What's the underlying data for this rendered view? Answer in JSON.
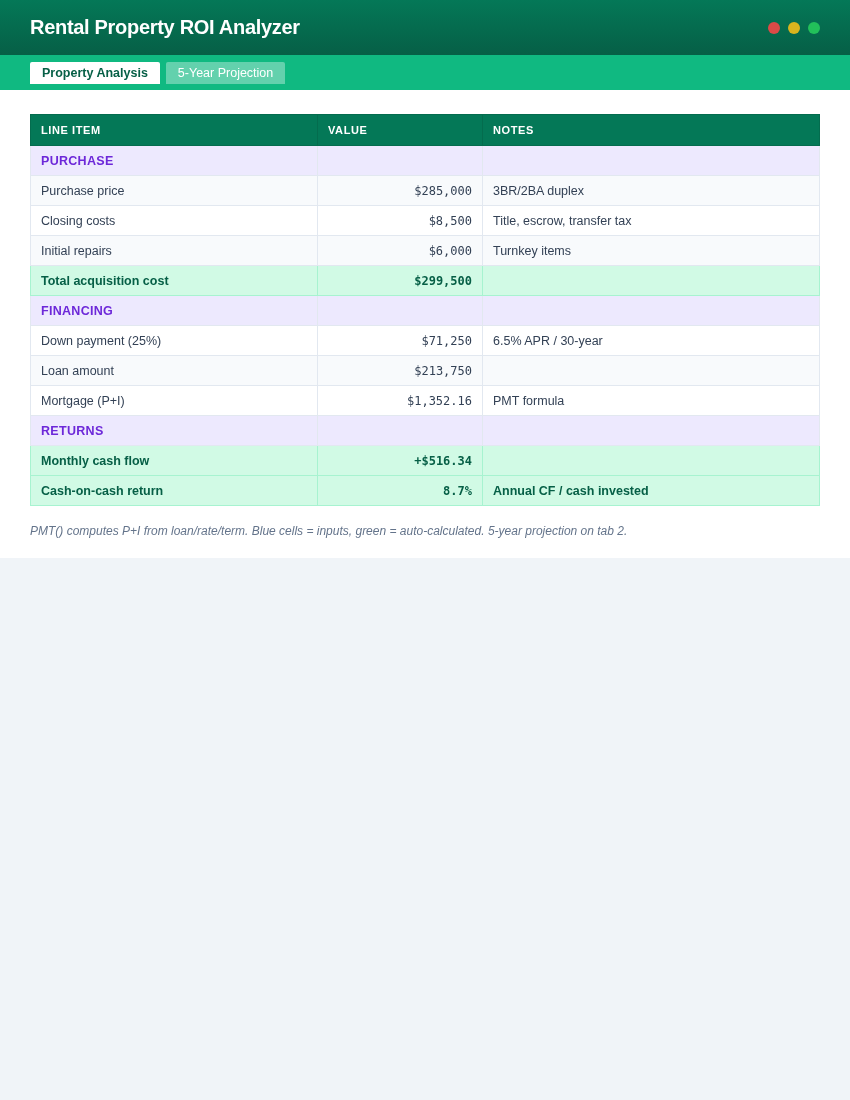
{
  "header": {
    "title": "Rental Property ROI Analyzer"
  },
  "tabs": [
    {
      "label": "Property Analysis",
      "selected": true
    },
    {
      "label": "5-Year Projection",
      "selected": false
    }
  ],
  "table": {
    "columns": [
      "LINE ITEM",
      "VALUE",
      "NOTES"
    ],
    "rows": [
      {
        "kind": "section",
        "label": "PURCHASE"
      },
      {
        "kind": "item",
        "label": "Purchase price",
        "value": "$285,000",
        "notes": "3BR/2BA duplex"
      },
      {
        "kind": "item",
        "label": "Closing costs",
        "value": "$8,500",
        "notes": "Title, escrow, transfer tax"
      },
      {
        "kind": "item",
        "label": "Initial repairs",
        "value": "$6,000",
        "notes": "Turnkey items"
      },
      {
        "kind": "total",
        "label": "Total acquisition cost",
        "value": "$299,500"
      },
      {
        "kind": "section",
        "label": "FINANCING"
      },
      {
        "kind": "item",
        "label": "Down payment (25%)",
        "value": "$71,250",
        "notes": "6.5% APR / 30-year"
      },
      {
        "kind": "item",
        "label": "Loan amount",
        "value": "$213,750"
      },
      {
        "kind": "item",
        "label": "Mortgage (P+I)",
        "value": "$1,352.16",
        "notes": "PMT formula"
      },
      {
        "kind": "section",
        "label": "RETURNS"
      },
      {
        "kind": "total",
        "label": "Monthly cash flow",
        "value": "+$516.34"
      },
      {
        "kind": "total",
        "label": "Cash-on-cash return",
        "value": "8.7%",
        "notes": "Annual CF / cash invested"
      }
    ]
  },
  "footnote": "PMT() computes P+I from loan/rate/term. Blue cells = inputs, green = auto-calculated. 5-year projection on tab 2."
}
